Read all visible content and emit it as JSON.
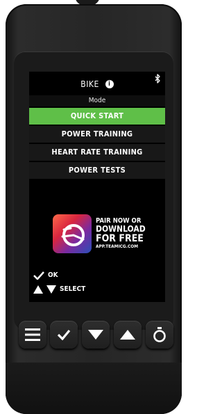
{
  "screen": {
    "title": "BIKE",
    "info_icon": "info-icon",
    "status_icon": "bluetooth-icon",
    "mode_label": "Mode",
    "menu_items": [
      {
        "label": "QUICK START",
        "selected": true
      },
      {
        "label": "POWER TRAINING",
        "selected": false
      },
      {
        "label": "HEART RATE TRAINING",
        "selected": false
      },
      {
        "label": "POWER TESTS",
        "selected": false
      }
    ],
    "promo": {
      "line1": "PAIR NOW OR",
      "line2": "DOWNLOAD",
      "line3": "FOR FREE",
      "url": "APP.TEAMICG.COM",
      "icon": "app-logo-icon"
    },
    "legend": {
      "ok_label": "OK",
      "select_label": "SELECT"
    }
  },
  "buttons": [
    {
      "name": "menu-button",
      "icon": "hamburger-icon"
    },
    {
      "name": "confirm-button",
      "icon": "checkmark-icon"
    },
    {
      "name": "down-button",
      "icon": "triangle-down-icon"
    },
    {
      "name": "up-button",
      "icon": "triangle-up-icon"
    },
    {
      "name": "timer-button",
      "icon": "stopwatch-icon"
    }
  ],
  "colors": {
    "accent": "#5fbf48",
    "screen_bg": "#000000",
    "device_body": "#262626"
  }
}
